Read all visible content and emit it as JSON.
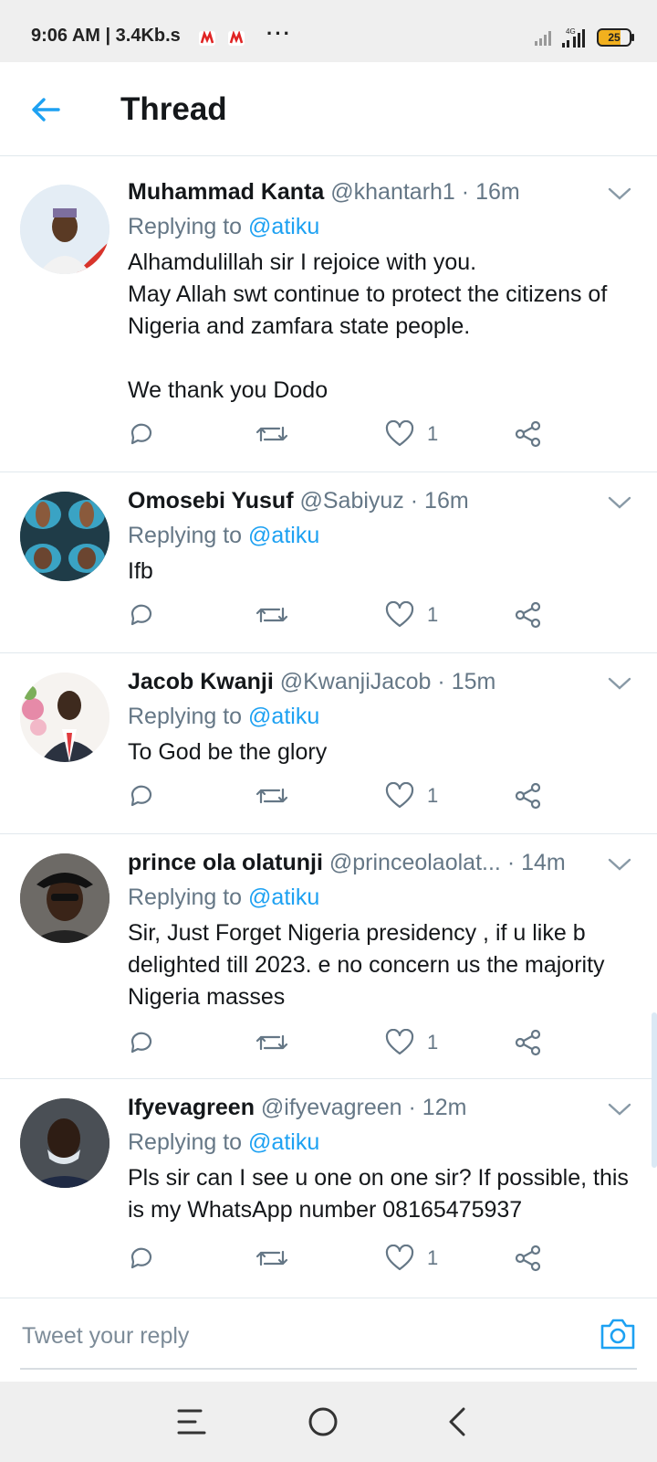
{
  "status_bar": {
    "time": "9:06 AM | 3.4Kb.s",
    "dots": "···",
    "battery": "25",
    "network": "4G"
  },
  "header": {
    "title": "Thread",
    "back_icon": "arrow-left-icon"
  },
  "tweets": [
    {
      "name": "Muhammad Kanta",
      "handle": "@khantarh1",
      "time": "· 16m",
      "replying_prefix": "Replying to",
      "replying_to": "@atiku",
      "body": "Alhamdulillah sir I rejoice with you.\nMay Allah swt continue to protect the citizens of Nigeria and zamfara state people.\n\nWe thank you Dodo",
      "likes": "1"
    },
    {
      "name": "Omosebi Yusuf",
      "handle": "@Sabiyuz",
      "time": "· 16m",
      "replying_prefix": "Replying to",
      "replying_to": "@atiku",
      "body": "Ifb",
      "likes": "1"
    },
    {
      "name": "Jacob Kwanji",
      "handle": "@KwanjiJacob",
      "time": "· 15m",
      "replying_prefix": "Replying to",
      "replying_to": "@atiku",
      "body": "To God be the glory",
      "likes": "1"
    },
    {
      "name": "prince ola olatunji",
      "handle": "@princeolaolat...",
      "time": "· 14m",
      "replying_prefix": "Replying to",
      "replying_to": "@atiku",
      "body": "Sir, Just Forget Nigeria presidency , if u like b delighted till 2023. e no concern us the majority  Nigeria masses",
      "likes": "1"
    },
    {
      "name": "Ifyevagreen",
      "handle": "@ifyevagreen",
      "time": "· 12m",
      "replying_prefix": "Replying to",
      "replying_to": "@atiku",
      "body": "Pls sir can I see u one on one sir? If possible, this is my WhatsApp number 08165475937",
      "likes": "1"
    }
  ],
  "reply_bar": {
    "placeholder": "Tweet your reply"
  },
  "colors": {
    "accent": "#1da1f2",
    "text": "#14171a",
    "muted": "#657786"
  }
}
